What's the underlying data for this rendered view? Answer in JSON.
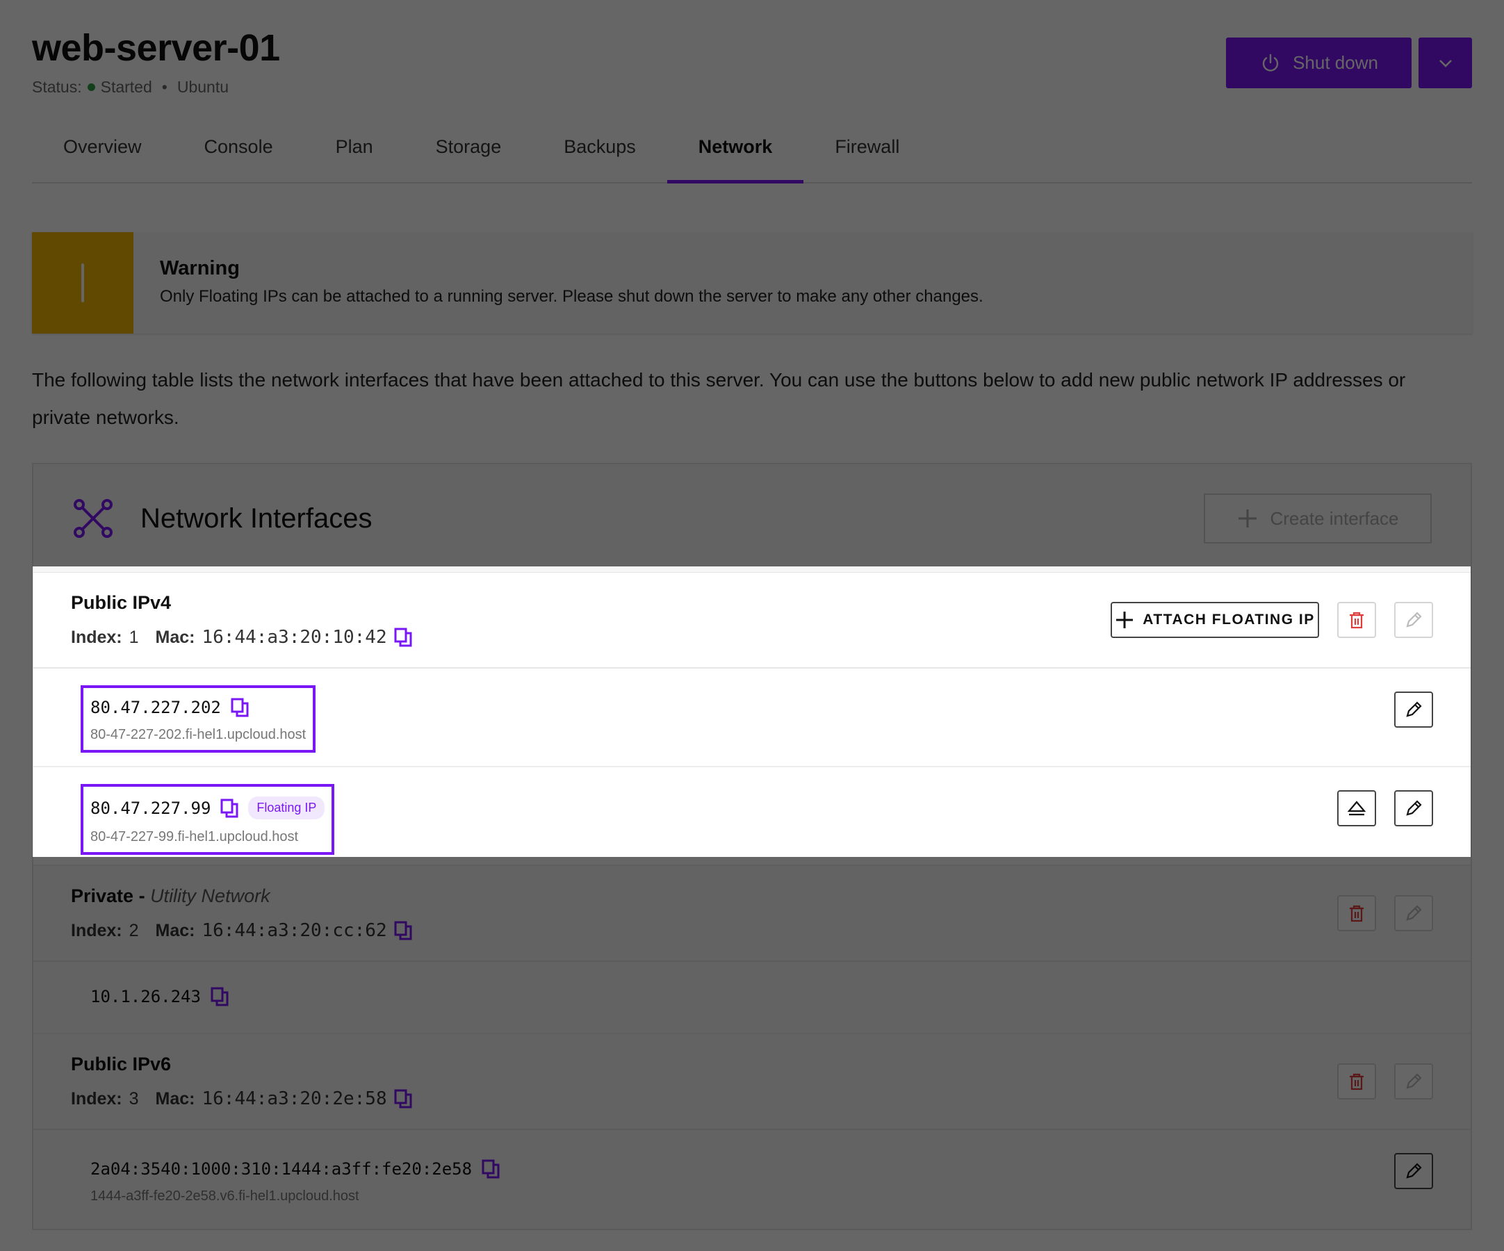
{
  "server": {
    "title": "web-server-01",
    "status_label": "Status:",
    "status_value": "Started",
    "separator": "•",
    "os": "Ubuntu",
    "shutdown_label": "Shut down"
  },
  "tabs": [
    {
      "label": "Overview"
    },
    {
      "label": "Console"
    },
    {
      "label": "Plan"
    },
    {
      "label": "Storage"
    },
    {
      "label": "Backups"
    },
    {
      "label": "Network",
      "active": true
    },
    {
      "label": "Firewall"
    }
  ],
  "warning": {
    "title": "Warning",
    "text": "Only Floating IPs can be attached to a running server. Please shut down the server to make any other changes."
  },
  "intro_text": "The following table lists the network interfaces that have been attached to this server. You can use the buttons below to add new public network IP addresses or private networks.",
  "card": {
    "title": "Network Interfaces",
    "create_label": "Create interface"
  },
  "labels": {
    "index": "Index:",
    "mac": "Mac:",
    "attach_floating_ip": "ATTACH FLOATING IP",
    "floating_badge": "Floating IP",
    "private_sep": " - "
  },
  "interfaces": [
    {
      "name": "Public IPv4",
      "index": "1",
      "mac": "16:44:a3:20:10:42",
      "ips": [
        {
          "address": "80.47.227.202",
          "host": "80-47-227-202.fi-hel1.upcloud.host"
        },
        {
          "address": "80.47.227.99",
          "host": "80-47-227-99.fi-hel1.upcloud.host",
          "floating": true
        }
      ]
    },
    {
      "name": "Private",
      "network": "Utility Network",
      "index": "2",
      "mac": "16:44:a3:20:cc:62",
      "ips": [
        {
          "address": "10.1.26.243"
        }
      ]
    },
    {
      "name": "Public IPv6",
      "index": "3",
      "mac": "16:44:a3:20:2e:58",
      "ips": [
        {
          "address": "2a04:3540:1000:310:1444:a3ff:fe20:2e58",
          "host": "1444-a3ff-fe20-2e58.v6.fi-hel1.upcloud.host"
        }
      ]
    }
  ],
  "colors": {
    "accent": "#7a18f5",
    "warning": "#f2b705",
    "danger": "#e03c3c",
    "status_ok": "#2ea043"
  },
  "icons": [
    "power-icon",
    "chevron-down-icon",
    "network-icon",
    "plus-icon",
    "copy-icon",
    "trash-icon",
    "pencil-icon",
    "eject-icon"
  ]
}
